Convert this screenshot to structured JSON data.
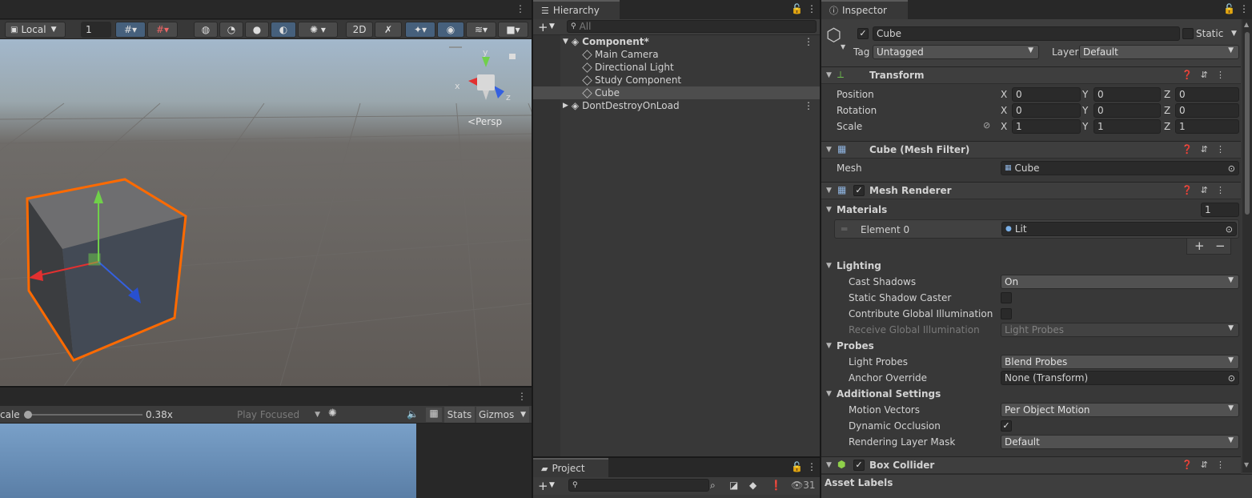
{
  "scene": {
    "pivot_mode": "Local",
    "grid_value": "1",
    "persp_label": "Persp",
    "gizmo_axes": {
      "y": "y",
      "x": "x",
      "z": "z"
    }
  },
  "game": {
    "scale_label": "cale",
    "scale_value": "0.38x",
    "scale_fraction": 0.03,
    "play_mode": "Play Focused",
    "stats_label": "Stats",
    "gizmos_label": "Gizmos"
  },
  "hierarchy": {
    "tab_label": "Hierarchy",
    "search_placeholder": "All",
    "items": [
      {
        "label": "Component*"
      },
      {
        "label": "Main Camera"
      },
      {
        "label": "Directional Light"
      },
      {
        "label": "Study Component"
      },
      {
        "label": "Cube"
      },
      {
        "label": "DontDestroyOnLoad"
      }
    ]
  },
  "project": {
    "tab_label": "Project",
    "badge_count": "31"
  },
  "inspector": {
    "tab_label": "Inspector",
    "object_name": "Cube",
    "static_label": "Static",
    "tag_label": "Tag",
    "tag_value": "Untagged",
    "layer_label": "Layer",
    "layer_value": "Default",
    "transform": {
      "title": "Transform",
      "rows": [
        {
          "label": "Position",
          "x": "0",
          "y": "0",
          "z": "0"
        },
        {
          "label": "Rotation",
          "x": "0",
          "y": "0",
          "z": "0"
        },
        {
          "label": "Scale",
          "x": "1",
          "y": "1",
          "z": "1"
        }
      ],
      "axis": {
        "x": "X",
        "y": "Y",
        "z": "Z"
      }
    },
    "mesh_filter": {
      "title": "Cube (Mesh Filter)",
      "mesh_label": "Mesh",
      "mesh_value": "Cube"
    },
    "mesh_renderer": {
      "title": "Mesh Renderer",
      "materials_label": "Materials",
      "materials_count": "1",
      "element_label": "Element 0",
      "element_value": "Lit",
      "lighting_label": "Lighting",
      "cast_shadows_label": "Cast Shadows",
      "cast_shadows_value": "On",
      "static_shadow_label": "Static Shadow Caster",
      "contribute_gi_label": "Contribute Global Illumination",
      "receive_gi_label": "Receive Global Illumination",
      "receive_gi_value": "Light Probes",
      "probes_label": "Probes",
      "light_probes_label": "Light Probes",
      "light_probes_value": "Blend Probes",
      "anchor_label": "Anchor Override",
      "anchor_value": "None (Transform)",
      "additional_label": "Additional Settings",
      "motion_vectors_label": "Motion Vectors",
      "motion_vectors_value": "Per Object Motion",
      "dynamic_occlusion_label": "Dynamic Occlusion",
      "rendering_layer_label": "Rendering Layer Mask",
      "rendering_layer_value": "Default"
    },
    "box_collider": {
      "title": "Box Collider"
    },
    "asset_labels": "Asset Labels"
  },
  "colors": {
    "selection_outline": "#ff6a00",
    "active_button": "#46607c",
    "panel_bg": "#383838"
  }
}
